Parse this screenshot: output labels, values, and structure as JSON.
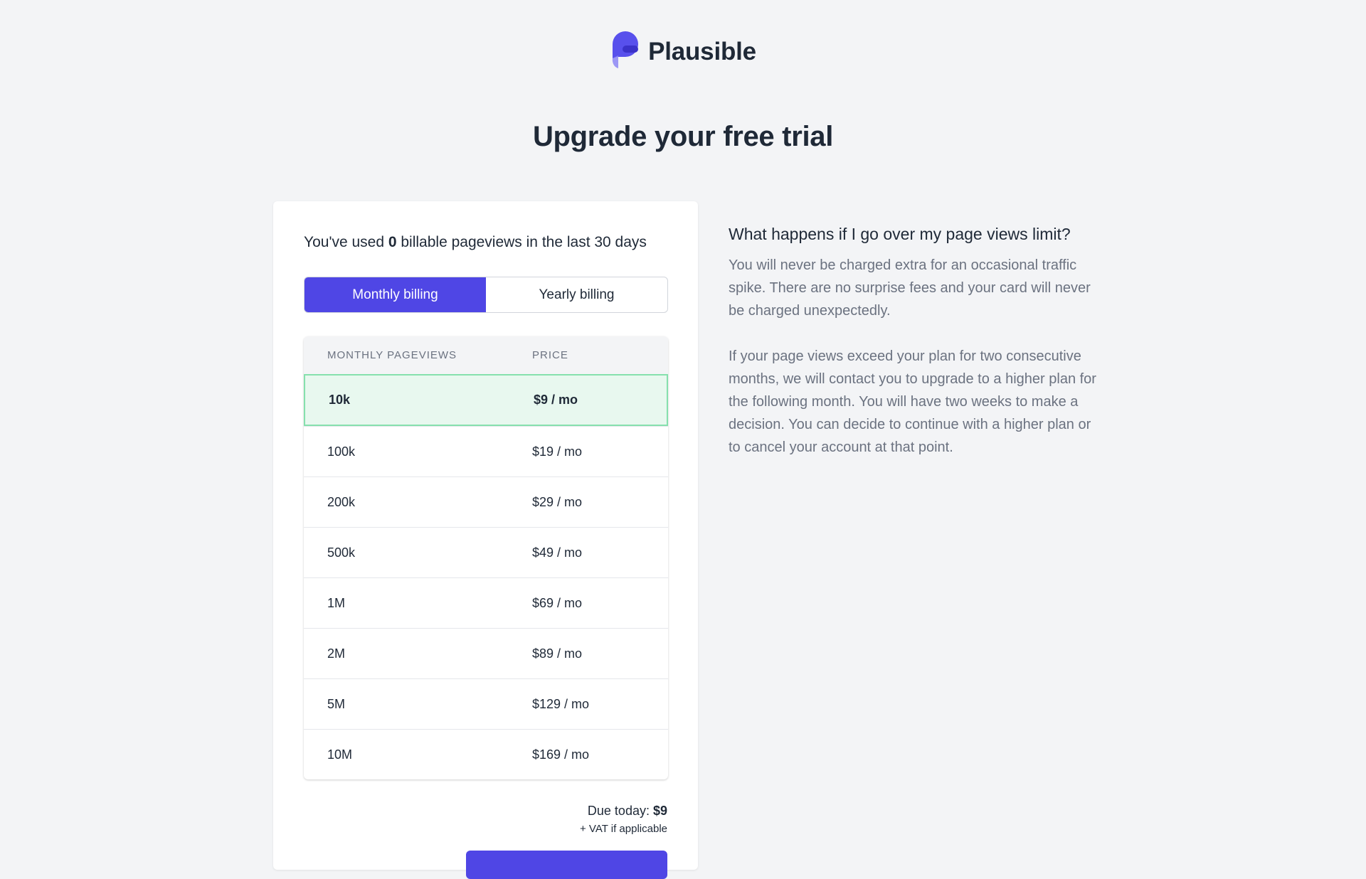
{
  "brand": {
    "name": "Plausible",
    "primary_color": "#4f46e5",
    "logo_icon": "plausible-logo-icon"
  },
  "page": {
    "title": "Upgrade your free trial"
  },
  "usage": {
    "prefix": "You've used ",
    "count": "0",
    "suffix": " billable pageviews in the last 30 days"
  },
  "billing_toggle": {
    "monthly_label": "Monthly billing",
    "yearly_label": "Yearly billing",
    "selected": "monthly"
  },
  "plans_table": {
    "headers": [
      "Monthly pageviews",
      "Price"
    ],
    "selected_index": 0,
    "rows": [
      {
        "pageviews": "10k",
        "price": "$9 / mo"
      },
      {
        "pageviews": "100k",
        "price": "$19 / mo"
      },
      {
        "pageviews": "200k",
        "price": "$29 / mo"
      },
      {
        "pageviews": "500k",
        "price": "$49 / mo"
      },
      {
        "pageviews": "1M",
        "price": "$69 / mo"
      },
      {
        "pageviews": "2M",
        "price": "$89 / mo"
      },
      {
        "pageviews": "5M",
        "price": "$129 / mo"
      },
      {
        "pageviews": "10M",
        "price": "$169 / mo"
      }
    ]
  },
  "checkout": {
    "due_label": "Due today: ",
    "due_amount": "$9",
    "vat_note": "+ VAT if applicable"
  },
  "faq": {
    "question": "What happens if I go over my page views limit?",
    "paragraph_1": "You will never be charged extra for an occasional traffic spike. There are no surprise fees and your card will never be charged unexpectedly.",
    "paragraph_2": "If your page views exceed your plan for two consecutive months, we will contact you to upgrade to a higher plan for the following month. You will have two weeks to make a decision. You can decide to continue with a higher plan or to cancel your account at that point."
  }
}
